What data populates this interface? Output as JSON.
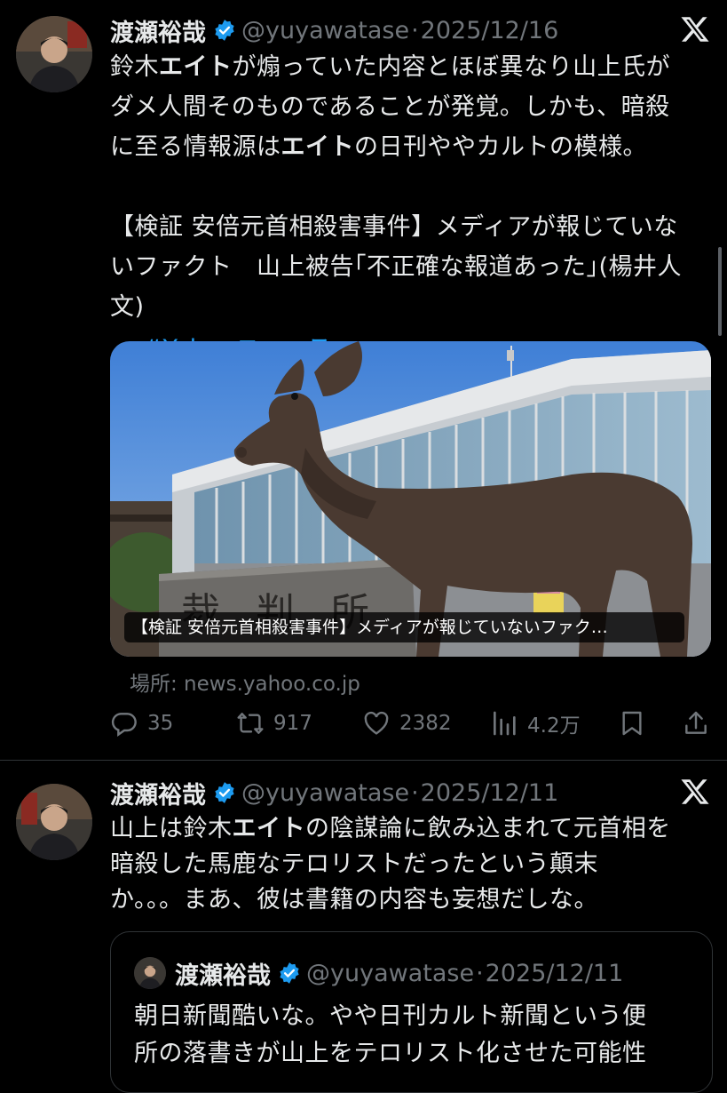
{
  "tweets": [
    {
      "name": "渡瀬裕哉",
      "handle": "@yuyawatase",
      "date": "2025/12/16",
      "text_parts": [
        {
          "t": "鈴木",
          "bold": false
        },
        {
          "t": "エイト",
          "bold": true
        },
        {
          "t": "が煽っていた内容とほぼ異なり山上氏が\nダメ人間そのものであることが発覚。しかも、暗殺\nに至る情報源は",
          "bold": false
        },
        {
          "t": "エイト",
          "bold": true
        },
        {
          "t": "の日刊ややカルトの模様。\n\n【検証 安倍元首相殺害事件】メディアが報じていな\nいファクト　山上被告｢不正確な報道あった｣(楊井人\n文)",
          "bold": false
        }
      ],
      "hashtag": "#Yahooニュース",
      "card": {
        "caption": "【検証 安倍元首相殺害事件】メディアが報じていないファク…",
        "sign_text": "裁判所",
        "source": "場所: news.yahoo.co.jp"
      },
      "stats": {
        "replies": "35",
        "retweets": "917",
        "likes": "2382",
        "views": "4.2万"
      }
    },
    {
      "name": "渡瀬裕哉",
      "handle": "@yuyawatase",
      "date": "2025/12/11",
      "text_parts": [
        {
          "t": "山上は鈴木",
          "bold": false
        },
        {
          "t": "エイト",
          "bold": true
        },
        {
          "t": "の陰謀論に飲み込まれて元首相を\n暗殺した馬鹿なテロリストだったという顛末\nか。。。まあ、彼は書籍の内容も妄想だしな。",
          "bold": false
        }
      ],
      "quote": {
        "name": "渡瀬裕哉",
        "handle": "@yuyawatase",
        "date": "2025/12/11",
        "text": "朝日新聞酷いな。やや日刊カルト新聞という便\n所の落書きが山上をテロリスト化させた可能性"
      }
    }
  ],
  "icons": {
    "verified": "verified-badge-icon",
    "platform": "x-logo-icon",
    "reply": "reply-icon",
    "retweet": "retweet-icon",
    "like": "heart-icon",
    "views": "views-icon",
    "bookmark": "bookmark-icon",
    "share": "share-icon"
  },
  "colors": {
    "background": "#000000",
    "text": "#e7e9ea",
    "muted": "#71767b",
    "link": "#1d9bf0",
    "verified": "#1d9bf0"
  }
}
